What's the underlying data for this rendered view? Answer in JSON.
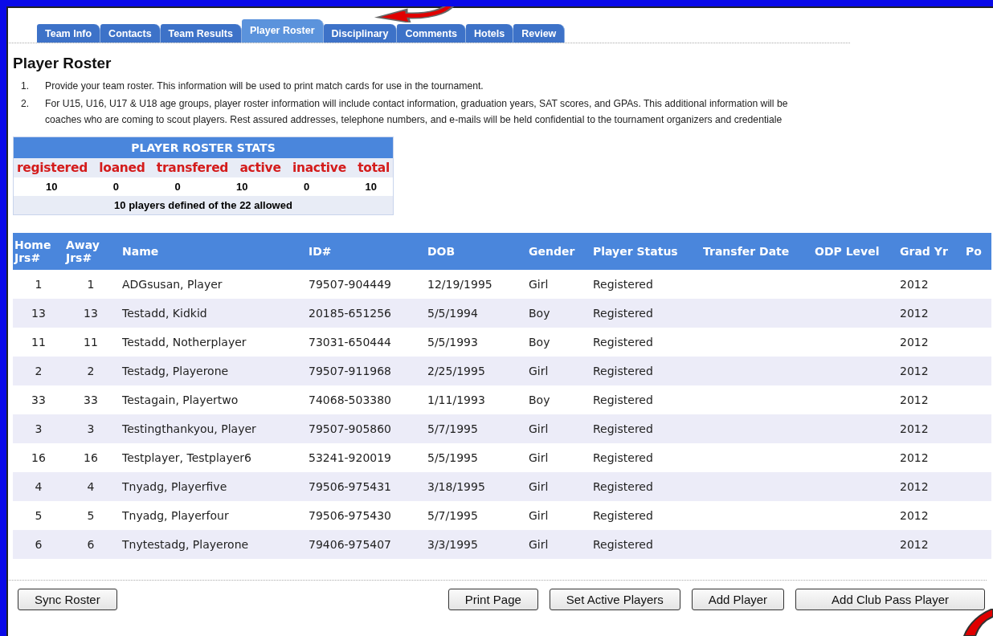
{
  "tabs": [
    {
      "label": "Team Info",
      "selected": false
    },
    {
      "label": "Contacts",
      "selected": false
    },
    {
      "label": "Team Results",
      "selected": false
    },
    {
      "label": "Player Roster",
      "selected": true
    },
    {
      "label": "Disciplinary",
      "selected": false
    },
    {
      "label": "Comments",
      "selected": false
    },
    {
      "label": "Hotels",
      "selected": false
    },
    {
      "label": "Review",
      "selected": false
    }
  ],
  "title": "Player Roster",
  "instructions": [
    {
      "number": "1.",
      "lines": [
        "Provide your team roster. This information will be used to print match cards for use in the tournament."
      ]
    },
    {
      "number": "2.",
      "lines": [
        "For U15, U16, U17 & U18 age groups, player roster information will include contact information, graduation years, SAT scores, and GPAs. This additional information will be",
        "coaches who are coming to scout players. Rest assured addresses, telephone numbers, and e-mails will be held confidential to the tournament organizers and credentiale"
      ]
    }
  ],
  "stats": {
    "title": "PLAYER ROSTER STATS",
    "labels": [
      "registered",
      "loaned",
      "transfered",
      "active",
      "inactive",
      "total"
    ],
    "values": [
      "10",
      "0",
      "0",
      "10",
      "0",
      "10"
    ],
    "summary": "10 players defined of the 22 allowed"
  },
  "table": {
    "columns": [
      "Home Jrs#",
      "Away Jrs#",
      "Name",
      "ID#",
      "DOB",
      "Gender",
      "Player Status",
      "Transfer Date",
      "ODP Level",
      "Grad Yr",
      "Po"
    ],
    "rows": [
      [
        "1",
        "1",
        "ADGsusan, Player",
        "79507-904449",
        "12/19/1995",
        "Girl",
        "Registered",
        "",
        "",
        "2012",
        ""
      ],
      [
        "13",
        "13",
        "Testadd, Kidkid",
        "20185-651256",
        "5/5/1994",
        "Boy",
        "Registered",
        "",
        "",
        "2012",
        ""
      ],
      [
        "11",
        "11",
        "Testadd, Notherplayer",
        "73031-650444",
        "5/5/1993",
        "Boy",
        "Registered",
        "",
        "",
        "2012",
        ""
      ],
      [
        "2",
        "2",
        "Testadg, Playerone",
        "79507-911968",
        "2/25/1995",
        "Girl",
        "Registered",
        "",
        "",
        "2012",
        ""
      ],
      [
        "33",
        "33",
        "Testagain, Playertwo",
        "74068-503380",
        "1/11/1993",
        "Boy",
        "Registered",
        "",
        "",
        "2012",
        ""
      ],
      [
        "3",
        "3",
        "Testingthankyou, Player",
        "79507-905860",
        "5/7/1995",
        "Girl",
        "Registered",
        "",
        "",
        "2012",
        ""
      ],
      [
        "16",
        "16",
        "Testplayer, Testplayer6",
        "53241-920019",
        "5/5/1995",
        "Girl",
        "Registered",
        "",
        "",
        "2012",
        ""
      ],
      [
        "4",
        "4",
        "Tnyadg, Playerfive",
        "79506-975431",
        "3/18/1995",
        "Girl",
        "Registered",
        "",
        "",
        "2012",
        ""
      ],
      [
        "5",
        "5",
        "Tnyadg, Playerfour",
        "79506-975430",
        "5/7/1995",
        "Girl",
        "Registered",
        "",
        "",
        "2012",
        ""
      ],
      [
        "6",
        "6",
        "Tnytestadg, Playerone",
        "79406-975407",
        "3/3/1995",
        "Girl",
        "Registered",
        "",
        "",
        "2012",
        ""
      ]
    ]
  },
  "buttons_left": [
    "Sync Roster"
  ],
  "buttons_right": [
    "Print Page",
    "Set Active Players",
    "Add Player",
    "Add Club Pass Player"
  ]
}
